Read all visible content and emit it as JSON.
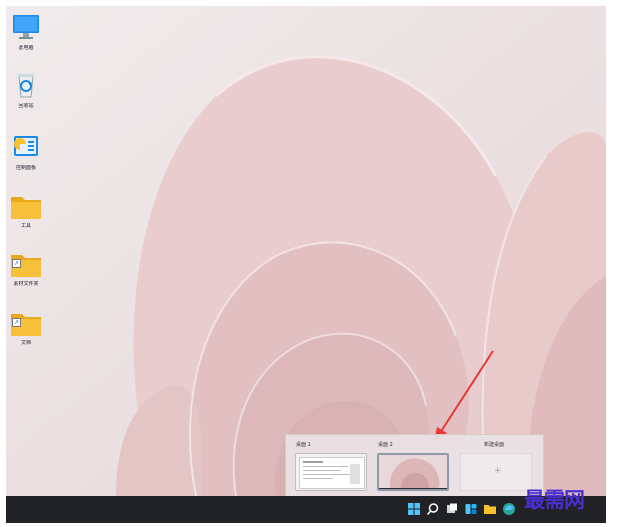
{
  "desktop": {
    "icons": [
      {
        "name": "此电脑",
        "icon": "computer-icon"
      },
      {
        "name": "回收站",
        "icon": "recycle-bin-icon"
      },
      {
        "name": "控制面板",
        "icon": "control-panel-icon"
      },
      {
        "name": "工具",
        "icon": "folder-icon"
      },
      {
        "name": "素材文件夹",
        "icon": "folder-shortcut-icon"
      },
      {
        "name": "文档",
        "icon": "folder-shortcut-icon"
      }
    ]
  },
  "task_view": {
    "desktops": [
      {
        "label": "桌面 1"
      },
      {
        "label": "桌面 2",
        "active": true
      }
    ],
    "new_desktop_label": "新建桌面",
    "new_desktop_plus": "+"
  },
  "taskbar": {
    "icons": [
      "start-icon",
      "search-icon",
      "task-view-icon",
      "widgets-icon",
      "file-explorer-icon",
      "edge-icon"
    ]
  },
  "watermark": "最需网",
  "colors": {
    "taskbar": "#202226",
    "wallpaper_base": "#eadfe0",
    "petal": "#e3c3c4",
    "arrow": "#e53935",
    "folder": "#f6c03a"
  }
}
